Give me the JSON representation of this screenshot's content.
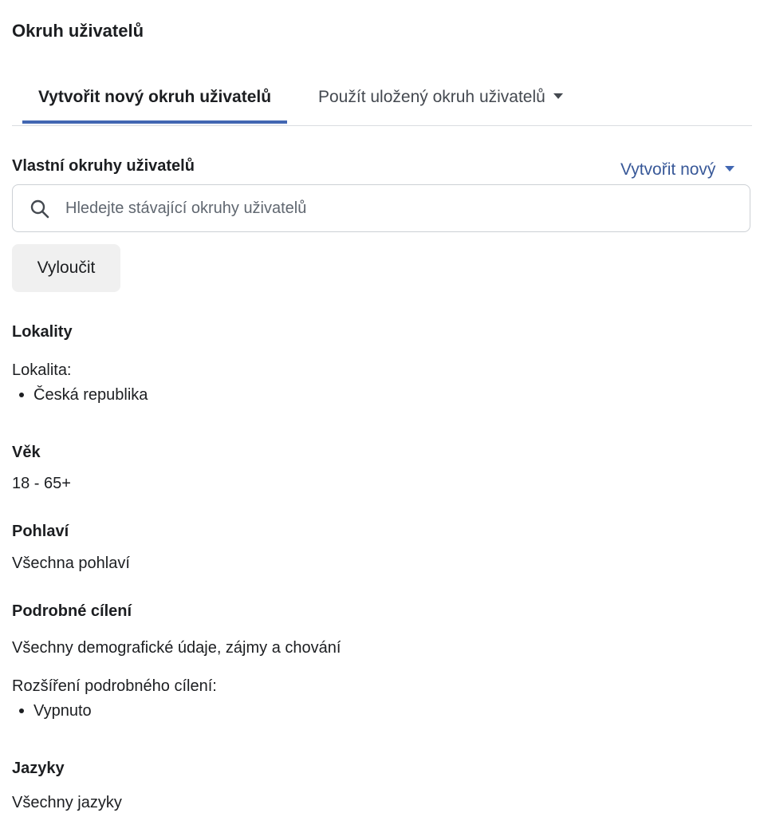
{
  "title": "Okruh uživatelů",
  "tabs": {
    "create": "Vytvořit nový okruh uživatelů",
    "saved": "Použít uložený okruh uživatelů"
  },
  "custom_audiences": {
    "label": "Vlastní okruhy uživatelů",
    "create_new": "Vytvořit nový",
    "search_placeholder": "Hledejte stávající okruhy uživatelů",
    "exclude_button": "Vyloučit"
  },
  "locations": {
    "heading": "Lokality",
    "label": "Lokalita:",
    "items": [
      "Česká republika"
    ]
  },
  "age": {
    "heading": "Věk",
    "value": "18 - 65+"
  },
  "gender": {
    "heading": "Pohlaví",
    "value": "Všechna pohlaví"
  },
  "detailed_targeting": {
    "heading": "Podrobné cílení",
    "value": "Všechny demografické údaje, zájmy a chování",
    "expansion_label": "Rozšíření podrobného cílení:",
    "expansion_items": [
      "Vypnuto"
    ]
  },
  "languages": {
    "heading": "Jazyky",
    "value": "Všechny jazyky"
  },
  "colors": {
    "accent": "#4267b2",
    "link": "#385898",
    "text": "#1c1e21"
  },
  "icons": {
    "search": "search-icon",
    "dropdown": "caret-down-icon"
  }
}
